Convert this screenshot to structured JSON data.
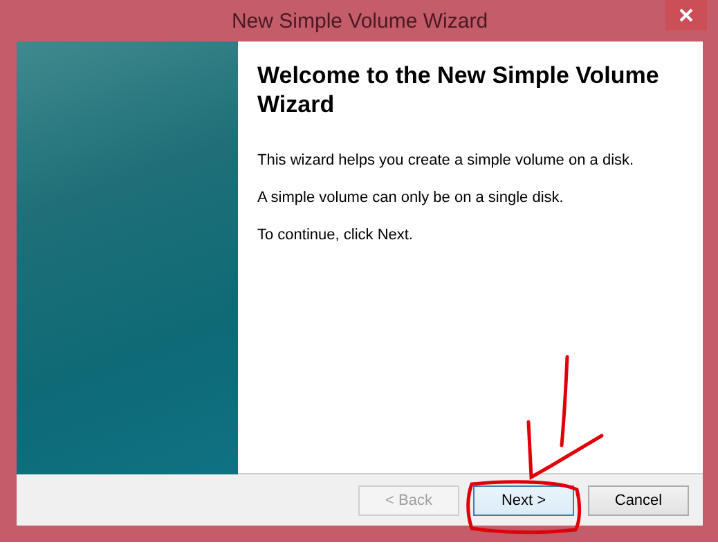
{
  "window": {
    "title": "New Simple Volume Wizard"
  },
  "page": {
    "heading": "Welcome to the New Simple Volume Wizard",
    "paragraphs": [
      "This wizard helps you create a simple volume on a disk.",
      "A simple volume can only be on a single disk.",
      "To continue, click Next."
    ]
  },
  "buttons": [
    {
      "label": "< Back",
      "disabled": true,
      "default": false
    },
    {
      "label": "Next >",
      "disabled": false,
      "default": true
    },
    {
      "label": "Cancel",
      "disabled": false,
      "default": false
    }
  ]
}
